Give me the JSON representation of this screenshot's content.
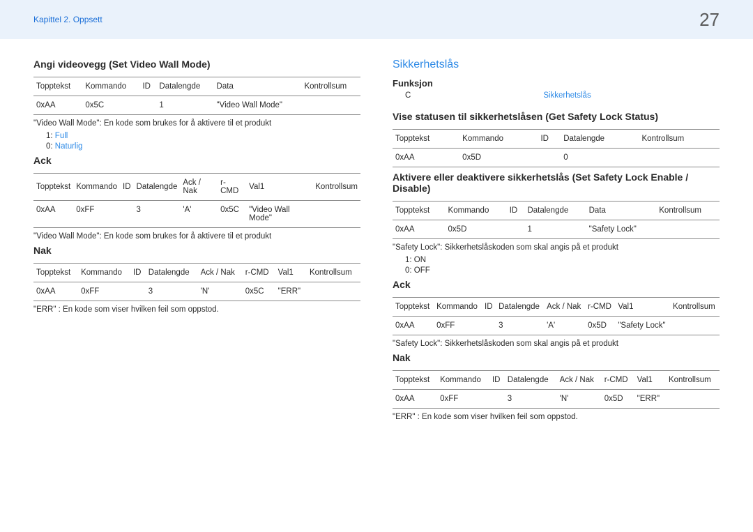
{
  "header": {
    "chapter": "Kapittel 2. Oppsett",
    "page": "27"
  },
  "left": {
    "title1": "Angi videovegg (Set Video Wall Mode)",
    "t1": {
      "h": [
        "Topptekst",
        "Kommando",
        "ID",
        "Datalengde",
        "Data",
        "Kontrollsum"
      ],
      "r": [
        "0xAA",
        "0x5C",
        "",
        "1",
        "\"Video Wall Mode\"",
        ""
      ]
    },
    "note1": "\"Video Wall Mode\": En kode som brukes for å aktivere til et produkt",
    "opt1a": "1:",
    "opt1aLink": "Full",
    "opt1b": "0:",
    "opt1bLink": "Naturlig",
    "ack": "Ack",
    "t2": {
      "h": [
        "Topptekst",
        "Kommando",
        "ID",
        "Datalengde",
        "Ack / Nak",
        "r-CMD",
        "Val1",
        "Kontrollsum"
      ],
      "r": [
        "0xAA",
        "0xFF",
        "",
        "3",
        "'A'",
        "0x5C",
        "\"Video Wall Mode\"",
        ""
      ]
    },
    "note2": "\"Video Wall Mode\": En kode som brukes for å aktivere til et produkt",
    "nak": "Nak",
    "t3": {
      "h": [
        "Topptekst",
        "Kommando",
        "ID",
        "Datalengde",
        "Ack / Nak",
        "r-CMD",
        "Val1",
        "Kontrollsum"
      ],
      "r": [
        "0xAA",
        "0xFF",
        "",
        "3",
        "'N'",
        "0x5C",
        "\"ERR\"",
        ""
      ]
    },
    "note3": "\"ERR\" : En kode som viser hvilken feil som oppstod."
  },
  "right": {
    "blueTitle": "Sikkerhetslås",
    "funksjon": "Funksjon",
    "fnC": "C",
    "fnLink": "Sikkerhetslås",
    "title2": "Vise statusen til sikkerhetslåsen (Get Safety Lock Status)",
    "t4": {
      "h": [
        "Topptekst",
        "Kommando",
        "ID",
        "Datalengde",
        "Kontrollsum"
      ],
      "r": [
        "0xAA",
        "0x5D",
        "",
        "0",
        ""
      ]
    },
    "title3": "Aktivere eller deaktivere sikkerhetslås (Set Safety Lock Enable / Disable)",
    "t5": {
      "h": [
        "Topptekst",
        "Kommando",
        "ID",
        "Datalengde",
        "Data",
        "Kontrollsum"
      ],
      "r": [
        "0xAA",
        "0x5D",
        "",
        "1",
        "\"Safety Lock\"",
        ""
      ]
    },
    "note4": "\"Safety Lock\": Sikkerhetslåskoden som skal angis på et produkt",
    "opt2a": "1: ON",
    "opt2b": "0: OFF",
    "ack": "Ack",
    "t6": {
      "h": [
        "Topptekst",
        "Kommando",
        "ID",
        "Datalengde",
        "Ack / Nak",
        "r-CMD",
        "Val1",
        "Kontrollsum"
      ],
      "r": [
        "0xAA",
        "0xFF",
        "",
        "3",
        "'A'",
        "0x5D",
        "\"Safety Lock\"",
        ""
      ]
    },
    "note5": "\"Safety Lock\": Sikkerhetslåskoden som skal angis på et produkt",
    "nak": "Nak",
    "t7": {
      "h": [
        "Topptekst",
        "Kommando",
        "ID",
        "Datalengde",
        "Ack / Nak",
        "r-CMD",
        "Val1",
        "Kontrollsum"
      ],
      "r": [
        "0xAA",
        "0xFF",
        "",
        "3",
        "'N'",
        "0x5D",
        "\"ERR\"",
        ""
      ]
    },
    "note6": "\"ERR\" : En kode som viser hvilken feil som oppstod."
  }
}
